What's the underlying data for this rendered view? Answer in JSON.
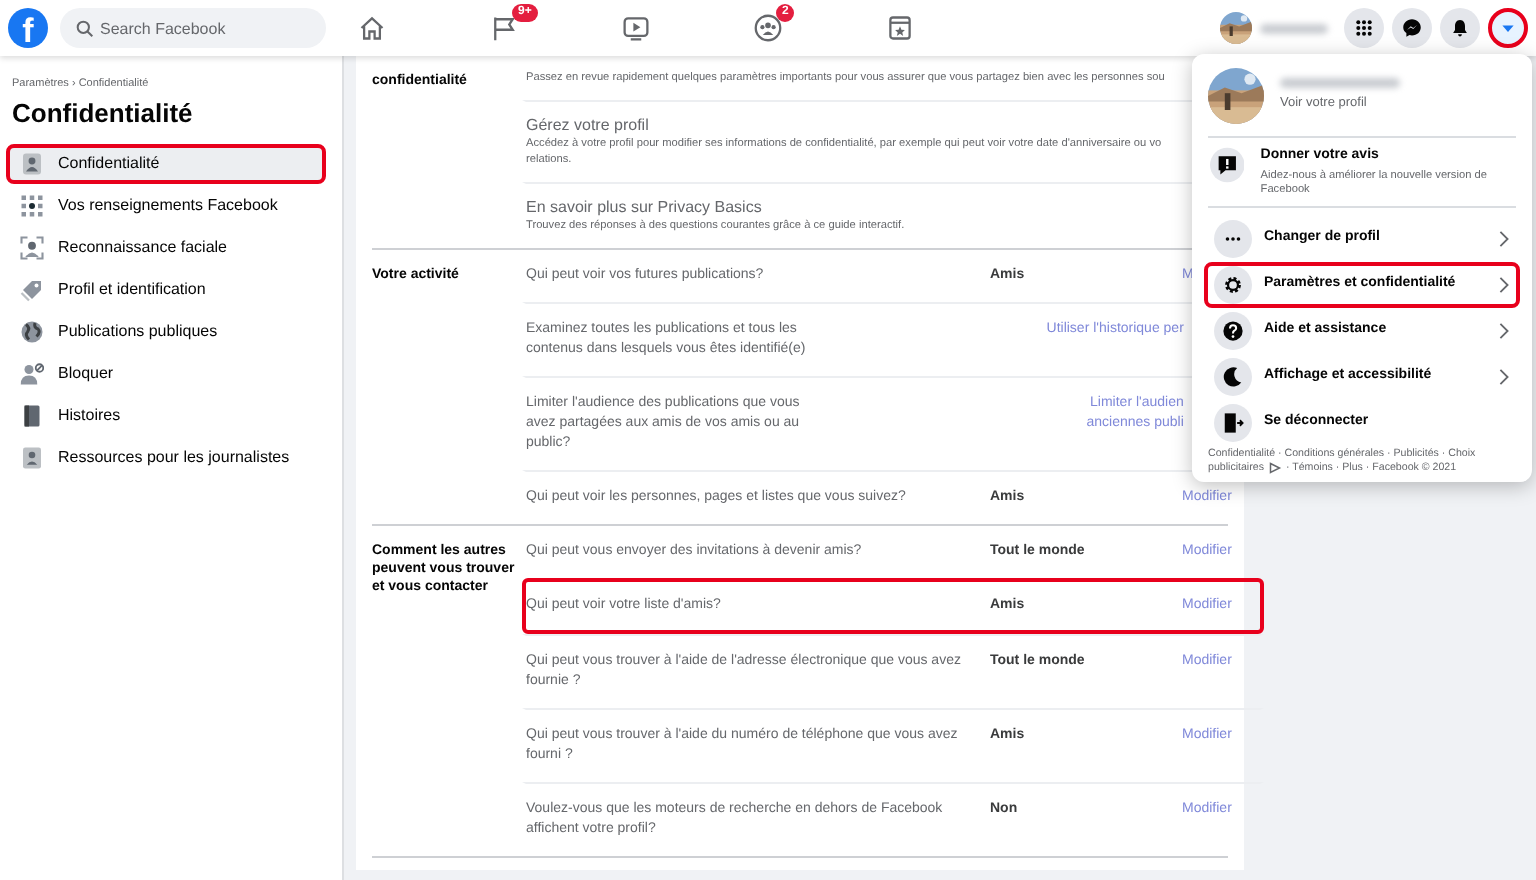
{
  "header": {
    "logo": "f",
    "search": {
      "placeholder": "Search Facebook"
    },
    "nav": [
      {
        "kind": "home"
      },
      {
        "kind": "flag",
        "badge": "9+"
      },
      {
        "kind": "video"
      },
      {
        "kind": "groups",
        "badge": "2"
      },
      {
        "kind": "gaming"
      }
    ],
    "buttons": [
      {
        "kind": "apps",
        "highlighted": false
      },
      {
        "kind": "messenger",
        "highlighted": false
      },
      {
        "kind": "bell",
        "highlighted": false
      },
      {
        "kind": "caret",
        "highlighted": true
      }
    ]
  },
  "sidebar": {
    "breadcrumb": "Paramètres › Confidentialité",
    "title": "Confidentialité",
    "items": [
      {
        "kind": "privacy",
        "label": "Confidentialité",
        "selected": true,
        "highlighted": true
      },
      {
        "kind": "info",
        "label": "Vos renseignements Facebook",
        "selected": false,
        "highlighted": false
      },
      {
        "kind": "face",
        "label": "Reconnaissance faciale",
        "selected": false,
        "highlighted": false
      },
      {
        "kind": "tag",
        "label": "Profil et identification",
        "selected": false,
        "highlighted": false
      },
      {
        "kind": "globe",
        "label": "Publications publiques",
        "selected": false,
        "highlighted": false
      },
      {
        "kind": "block",
        "label": "Bloquer",
        "selected": false,
        "highlighted": false
      },
      {
        "kind": "book",
        "label": "Histoires",
        "selected": false,
        "highlighted": false
      },
      {
        "kind": "press",
        "label": "Ressources pour les journalistes",
        "selected": false,
        "highlighted": false
      }
    ]
  },
  "sections": [
    {
      "label": "confidentialité",
      "rows": [
        {
          "kind": "info",
          "description_lines": [
            "Passez en revue rapidement quelques paramètres importants pour vous assurer que vous partagez bien avec les personnes sou"
          ]
        },
        {
          "kind": "info",
          "title": "Gérez votre profil",
          "description_lines": [
            "Accédez à votre profil pour modifier ses informations de confidentialité, par exemple qui peut voir votre date d'anniversaire ou vo",
            "relations."
          ]
        },
        {
          "kind": "info",
          "title": "En savoir plus sur Privacy Basics",
          "description_lines": [
            "Trouvez des réponses à des questions courantes grâce à ce guide interactif."
          ]
        }
      ]
    },
    {
      "label": "Votre activité",
      "rows": [
        {
          "kind": "setting",
          "question": "Qui peut voir vos futures publications?",
          "value": "Amis",
          "action_lines": [
            "M"
          ],
          "highlighted": false
        },
        {
          "kind": "link",
          "question": "Examinez toutes les publications et tous les contenus dans lesquels vous êtes identifié(e)",
          "action_lines": [
            "Utiliser l'historique per"
          ],
          "highlighted": false
        },
        {
          "kind": "link",
          "question": "Limiter l'audience des publications que vous avez partagées aux amis de vos amis ou au public?",
          "action_lines": [
            "Limiter l'audien",
            "anciennes publi"
          ],
          "highlighted": false
        },
        {
          "kind": "setting",
          "question": "Qui peut voir les personnes, pages et listes que vous suivez?",
          "value": "Amis",
          "action_lines": [
            "Modifier"
          ],
          "highlighted": false
        }
      ]
    },
    {
      "label": "Comment les autres peuvent vous trouver et vous contacter",
      "rows": [
        {
          "kind": "setting",
          "question": "Qui peut vous envoyer des invitations à devenir amis?",
          "value": "Tout le monde",
          "action_lines": [
            "Modifier"
          ],
          "highlighted": false
        },
        {
          "kind": "setting",
          "question": "Qui peut voir votre liste d'amis?",
          "value": "Amis",
          "action_lines": [
            "Modifier"
          ],
          "highlighted": true
        },
        {
          "kind": "setting",
          "question": "Qui peut vous trouver à l'aide de l'adresse électronique que vous avez fournie ?",
          "value": "Tout le monde",
          "action_lines": [
            "Modifier"
          ],
          "highlighted": false
        },
        {
          "kind": "setting",
          "question": "Qui peut vous trouver à l'aide du numéro de téléphone que vous avez fourni ?",
          "value": "Amis",
          "action_lines": [
            "Modifier"
          ],
          "highlighted": false
        },
        {
          "kind": "setting",
          "question": "Voulez-vous que les moteurs de recherche en dehors de Facebook affichent votre profil?",
          "value": "Non",
          "action_lines": [
            "Modifier"
          ],
          "highlighted": false
        }
      ]
    }
  ],
  "menu": {
    "profile_link": "Voir votre profil",
    "feedback": {
      "title": "Donner votre avis",
      "description": "Aidez-nous à améliorer la nouvelle version de Facebook"
    },
    "items": [
      {
        "kind": "dots",
        "label": "Changer de profil",
        "submenu": true,
        "highlighted": false
      },
      {
        "kind": "gear",
        "label": "Paramètres et confidentialité",
        "submenu": true,
        "highlighted": true
      },
      {
        "kind": "help",
        "label": "Aide et assistance",
        "submenu": true,
        "highlighted": false
      },
      {
        "kind": "moon",
        "label": "Affichage et accessibilité",
        "submenu": true,
        "highlighted": false
      },
      {
        "kind": "logout",
        "label": "Se déconnecter",
        "submenu": false,
        "highlighted": false
      }
    ],
    "footer": {
      "line_1": "Confidentialité · Conditions générales · Publicités · Choix",
      "line_2_before": "publicitaires",
      "line_2_after": "· Témoins · Plus · Facebook © 2021"
    }
  }
}
